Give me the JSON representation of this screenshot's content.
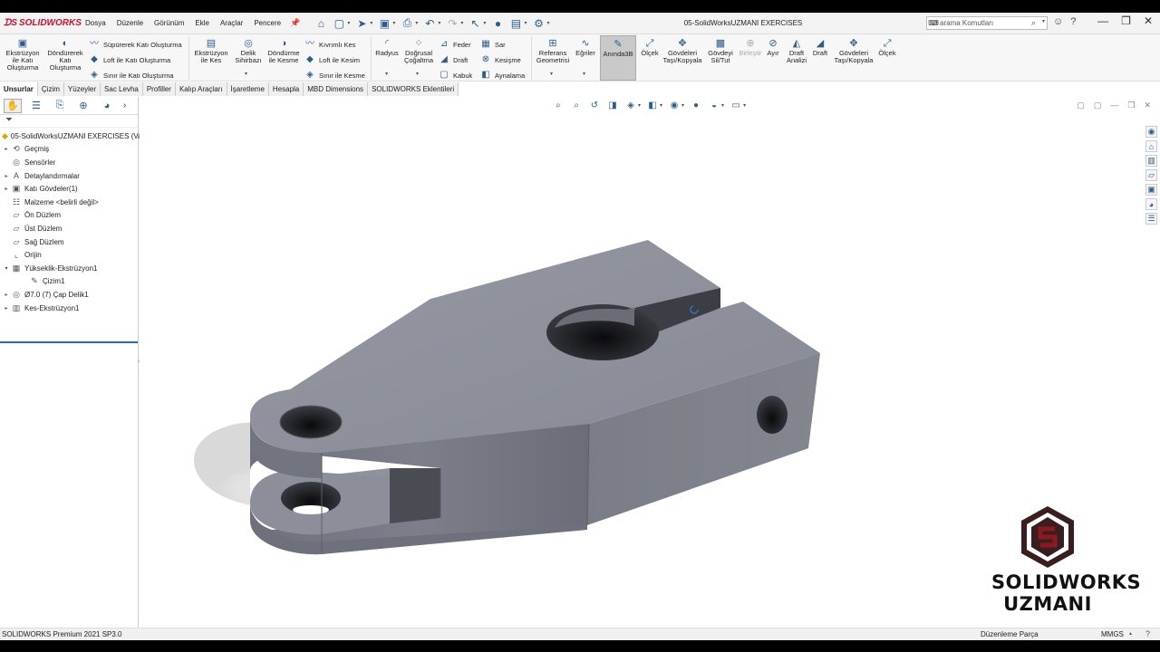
{
  "app": {
    "logo_text": "SOLIDWORKS",
    "menu": [
      "Dosya",
      "Düzenle",
      "Görünüm",
      "Ekle",
      "Araçlar",
      "Pencere"
    ],
    "document_title": "05-SolidWorksUZMANI EXERCISES",
    "search_placeholder": "arama Komutları"
  },
  "ribbon": {
    "extrude_boss": "Ekstrüzyon ile Katı Oluşturma",
    "revolve_boss": "Döndürerek Katı Oluşturma",
    "swept_boss": "Süpürerek Katı Oluşturma",
    "loft_boss": "Loft ile Katı Oluşturma",
    "boundary_boss": "Sınır ile Katı Oluşturma",
    "extrude_cut": "Ekstrüzyon ile Kes",
    "hole_wizard": "Delik Sihirbazı",
    "revolve_cut": "Döndürme ile Kesme",
    "swept_cut": "Kıvrımlı Kes",
    "loft_cut": "Loft ile Kesim",
    "boundary_cut": "Sınır ile Kesme",
    "fillet": "Radyus",
    "linear_pattern": "Doğrusal Çoğaltma",
    "rib": "Feder",
    "draft": "Draft",
    "shell": "Kabuk",
    "wrap": "Sar",
    "intersect": "Kesişme",
    "mirror": "Aynalama",
    "ref_geometry": "Referans Geometrisi",
    "curves": "Eğriler",
    "instant3d": "Anında3B",
    "scale": "Ölçek",
    "move_copy_bodies": "Gövdeleri Taşı/Kopyala",
    "delete_keep_body": "Gövdeyi Sil/Tut",
    "combine": "Birleştir",
    "split": "Ayır",
    "draft_analysis": "Draft Analizi",
    "draft2": "Draft",
    "move_copy_bodies2": "Gövdeleri Taşı/Kopyala",
    "scale2": "Ölçek"
  },
  "tabs": [
    "Unsurlar",
    "Çizim",
    "Yüzeyler",
    "Sac Levha",
    "Profiller",
    "Kalıp Araçları",
    "İşaretleme",
    "Hesapla",
    "MBD Dimensions",
    "SOLIDWORKS Eklentileri"
  ],
  "active_tab": "Unsurlar",
  "feature_tree": [
    {
      "label": "05-SolidWorksUZMANI EXERCISES  (Va",
      "icon": "part-icon",
      "expand": "",
      "indent": 0
    },
    {
      "label": "Geçmiş",
      "icon": "history-icon",
      "expand": "▸",
      "indent": 1
    },
    {
      "label": "Sensörler",
      "icon": "sensor-icon",
      "expand": "",
      "indent": 1
    },
    {
      "label": "Detaylandırmalar",
      "icon": "annotations-icon",
      "expand": "▸",
      "indent": 1
    },
    {
      "label": "Katı Gövdeler(1)",
      "icon": "solid-bodies-icon",
      "expand": "▸",
      "indent": 1
    },
    {
      "label": "Malzeme <belirli değil>",
      "icon": "material-icon",
      "expand": "",
      "indent": 1
    },
    {
      "label": "Ön Düzlem",
      "icon": "plane-icon",
      "expand": "",
      "indent": 1
    },
    {
      "label": "Üst Düzlem",
      "icon": "plane-icon",
      "expand": "",
      "indent": 1
    },
    {
      "label": "Sağ Düzlem",
      "icon": "plane-icon",
      "expand": "",
      "indent": 1
    },
    {
      "label": "Orijin",
      "icon": "origin-icon",
      "expand": "",
      "indent": 1
    },
    {
      "label": "Yükseklik-Ekstrüzyon1",
      "icon": "extrude-feature-icon",
      "expand": "▾",
      "indent": 1
    },
    {
      "label": "Çizim1",
      "icon": "sketch-icon",
      "expand": "",
      "indent": 2
    },
    {
      "label": "Ø7.0 (7) Çap Delik1",
      "icon": "hole-feature-icon",
      "expand": "▸",
      "indent": 1
    },
    {
      "label": "Kes-Ekstrüzyon1",
      "icon": "cut-feature-icon",
      "expand": "▸",
      "indent": 1
    }
  ],
  "brand": {
    "line1": "SOLIDWORKS",
    "line2": "UZMANI"
  },
  "status": {
    "product": "SOLIDWORKS Premium 2021 SP3.0",
    "mode": "Düzenleme Parça",
    "units": "MMGS"
  },
  "colors": {
    "accent": "#c8102e",
    "model_face_top": "#8e919b",
    "model_face_side": "#757883",
    "brand_dark": "#3a1d1f",
    "brand_red": "#8b1a1f"
  }
}
